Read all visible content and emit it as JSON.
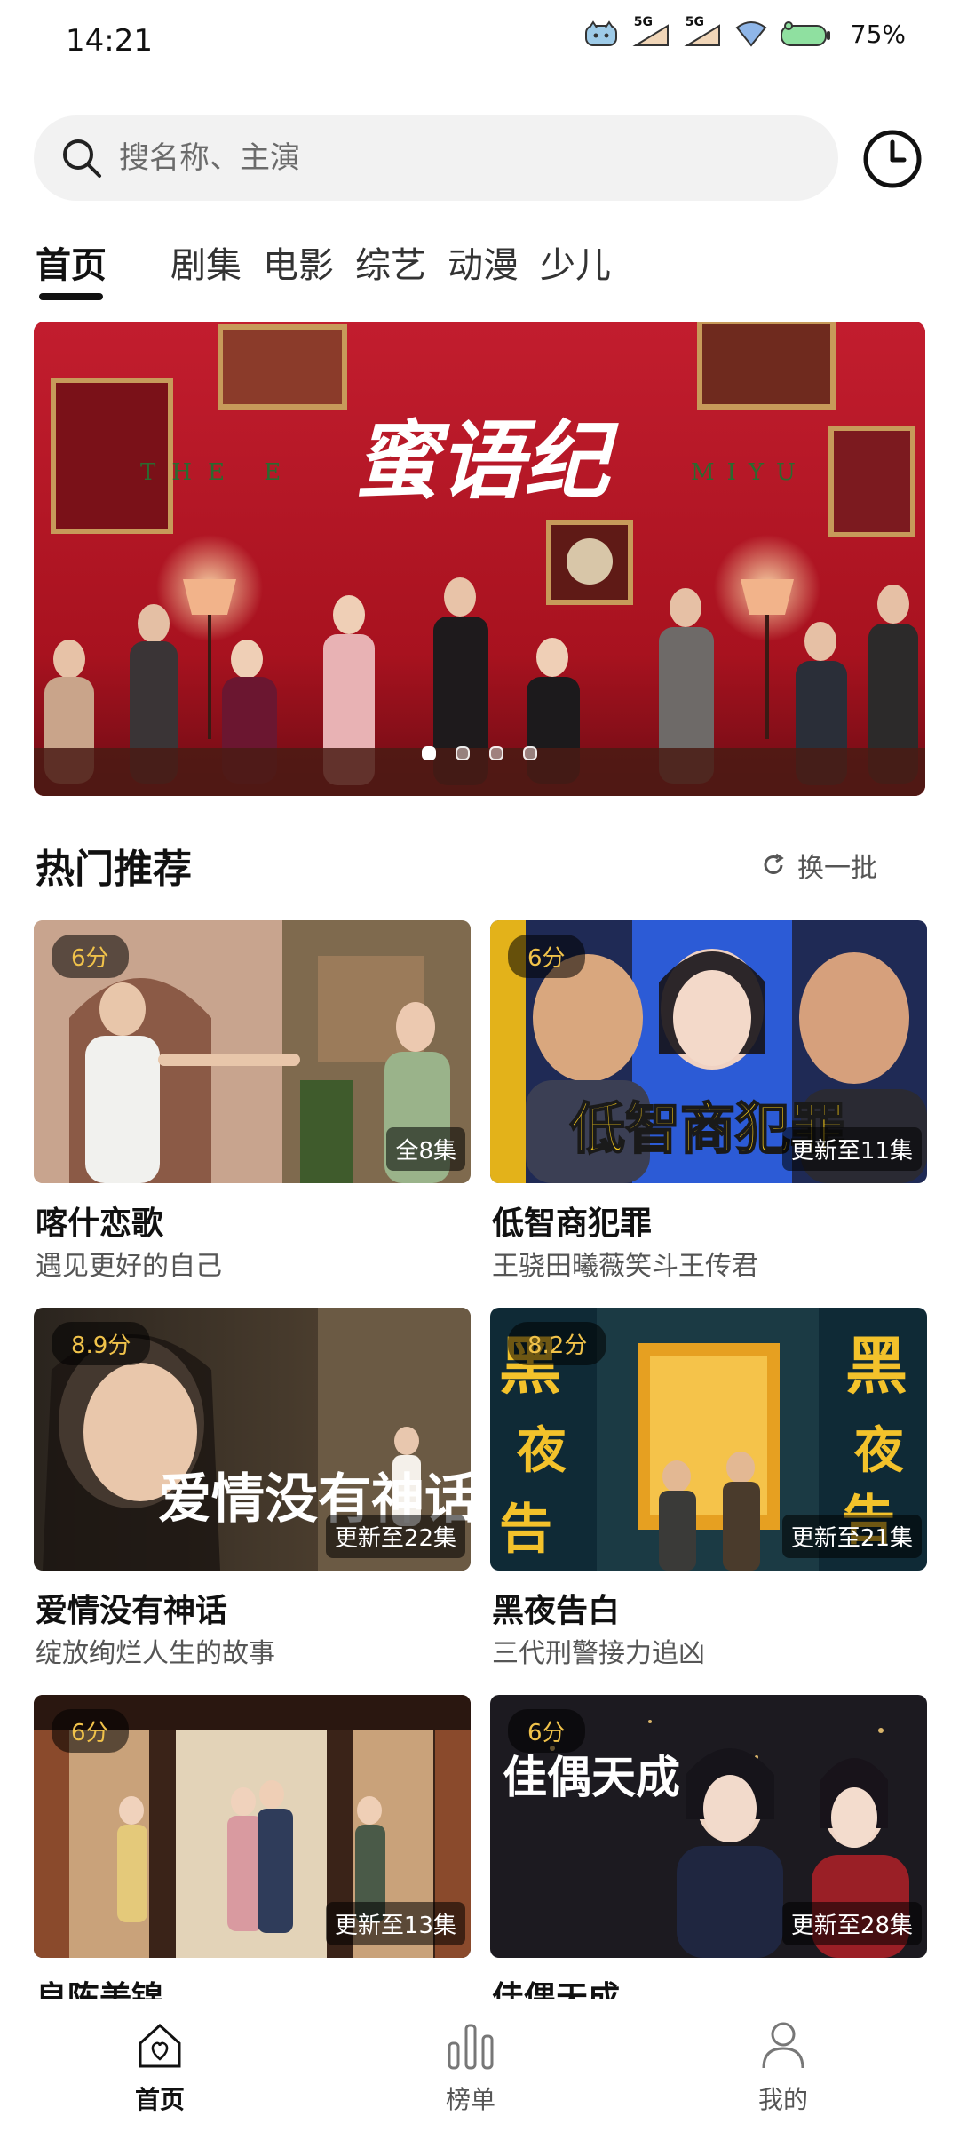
{
  "status_bar": {
    "time": "14:21",
    "signal1": "5G",
    "signal2": "5G",
    "battery": "75%"
  },
  "search": {
    "placeholder": "搜名称、主演",
    "icon": "search-icon",
    "history_icon": "clock-icon"
  },
  "tabs": [
    {
      "label": "首页",
      "active": true
    },
    {
      "label": "剧集",
      "active": false
    },
    {
      "label": "电影",
      "active": false
    },
    {
      "label": "综艺",
      "active": false
    },
    {
      "label": "动漫",
      "active": false
    },
    {
      "label": "少儿",
      "active": false
    }
  ],
  "banner": {
    "calligraphy": "蜜语纪",
    "subtitle_left": "THE E",
    "subtitle_right": "MIYU",
    "dots": 4,
    "active_dot": 0
  },
  "section": {
    "title": "热门推荐",
    "refresh_label": "换一批"
  },
  "cards": [
    {
      "title": "喀什恋歌",
      "subtitle": "遇见更好的自己",
      "score": "6分",
      "episodes": "全8集",
      "poster_text": ""
    },
    {
      "title": "低智商犯罪",
      "subtitle": "王骁田曦薇笑斗王传君",
      "score": "6分",
      "episodes": "更新至11集",
      "poster_text": "低智商犯罪"
    },
    {
      "title": "爱情没有神话",
      "subtitle": "绽放绚烂人生的故事",
      "score": "8.9分",
      "episodes": "更新至22集",
      "poster_text": "爱情没有神话"
    },
    {
      "title": "黑夜告白",
      "subtitle": "三代刑警接力追凶",
      "score": "8.2分",
      "episodes": "更新至21集",
      "poster_text": "黑夜告白"
    },
    {
      "title": "良陈美锦",
      "subtitle": "",
      "score": "6分",
      "episodes": "更新至13集",
      "poster_text": ""
    },
    {
      "title": "佳偶天成",
      "subtitle": "",
      "score": "6分",
      "episodes": "更新至28集",
      "poster_text": "佳偶天成"
    }
  ],
  "bottom_nav": [
    {
      "label": "首页",
      "icon": "home-icon",
      "active": true
    },
    {
      "label": "榜单",
      "icon": "chart-icon",
      "active": false
    },
    {
      "label": "我的",
      "icon": "user-icon",
      "active": false
    }
  ],
  "colors": {
    "score_text": "#f0c24a",
    "banner_red": "#b81c2b"
  }
}
